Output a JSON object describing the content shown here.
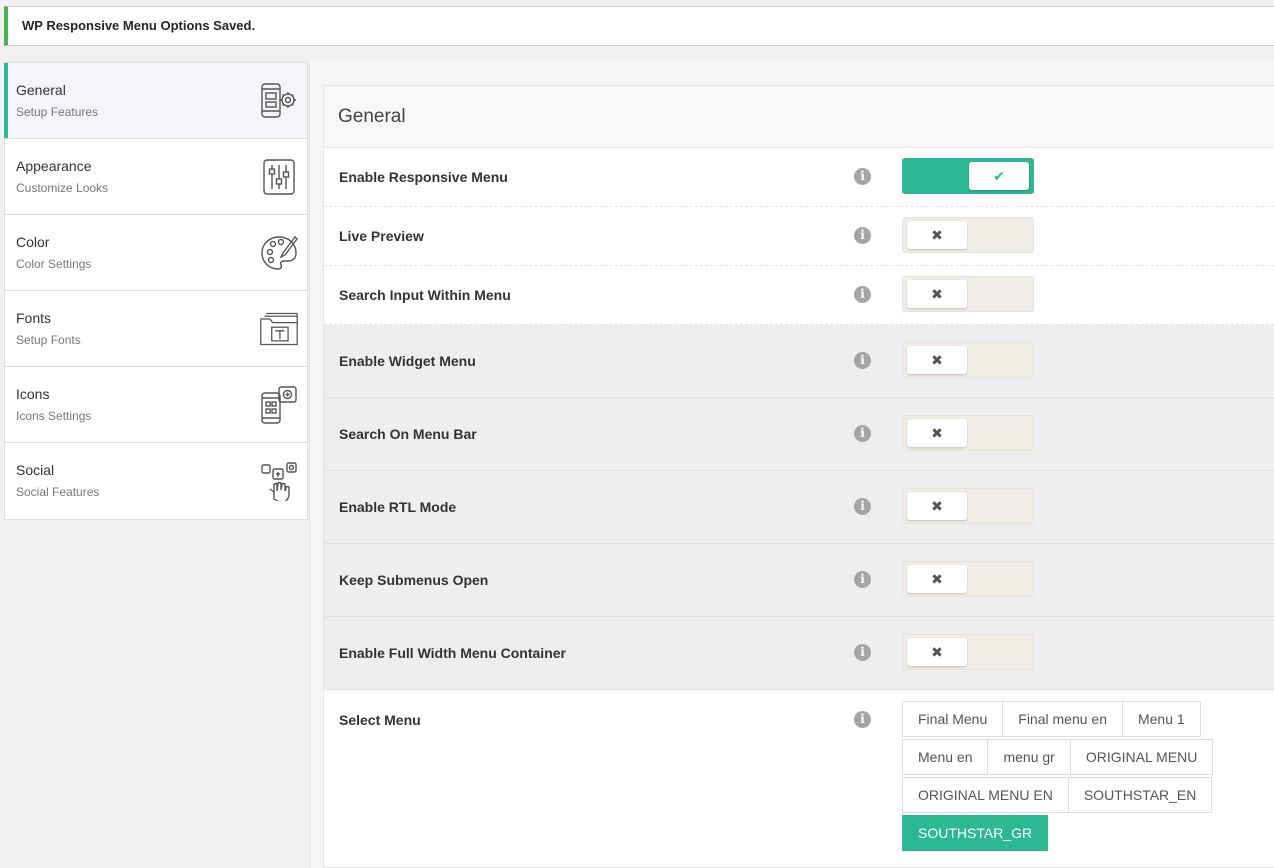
{
  "notice": {
    "text": "WP Responsive Menu Options Saved."
  },
  "sidebar": {
    "items": [
      {
        "title": "General",
        "subtitle": "Setup Features",
        "icon": "mobile-gear-icon",
        "active": true
      },
      {
        "title": "Appearance",
        "subtitle": "Customize Looks",
        "icon": "sliders-icon"
      },
      {
        "title": "Color",
        "subtitle": "Color Settings",
        "icon": "palette-icon"
      },
      {
        "title": "Fonts",
        "subtitle": "Setup Fonts",
        "icon": "font-folder-icon"
      },
      {
        "title": "Icons",
        "subtitle": "Icons Settings",
        "icon": "mobile-icons-icon"
      },
      {
        "title": "Social",
        "subtitle": "Social Features",
        "icon": "social-hand-icon"
      }
    ]
  },
  "panel": {
    "title": "General",
    "info_glyph": "i",
    "on_glyph": "✔",
    "off_glyph": "✖",
    "settings": [
      {
        "label": "Enable Responsive Menu",
        "enabled": true
      },
      {
        "label": "Live Preview",
        "enabled": false
      },
      {
        "label": "Search Input Within Menu",
        "enabled": false
      },
      {
        "label": "Enable Widget Menu",
        "enabled": false
      },
      {
        "label": "Search On Menu Bar",
        "enabled": false
      },
      {
        "label": "Enable RTL Mode",
        "enabled": false
      },
      {
        "label": "Keep Submenus Open",
        "enabled": false
      },
      {
        "label": "Enable Full Width Menu Container",
        "enabled": false
      }
    ],
    "select_menu": {
      "label": "Select Menu",
      "options": [
        "Final Menu",
        "Final menu en",
        "Menu 1",
        "Menu en",
        "menu gr",
        "ORIGINAL MENU",
        "ORIGINAL MENU EN",
        "SOUTHSTAR_EN",
        "SOUTHSTAR_GR"
      ],
      "selected": "SOUTHSTAR_GR"
    }
  },
  "colors": {
    "accent": "#2db894",
    "notice_border": "#46b450"
  }
}
